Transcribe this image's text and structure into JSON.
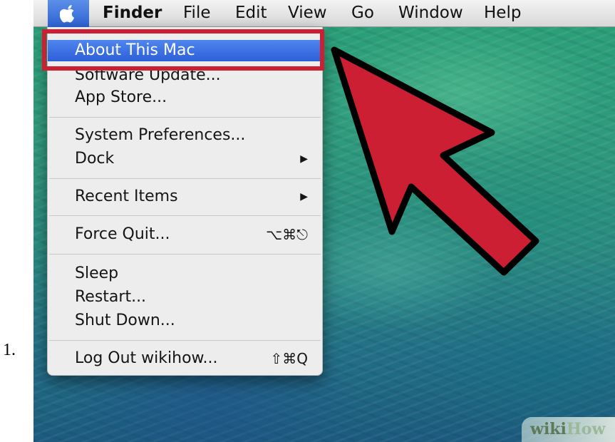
{
  "list_number": "1.",
  "menubar": {
    "items": [
      "Finder",
      "File",
      "Edit",
      "View",
      "Go",
      "Window",
      "Help"
    ]
  },
  "apple_menu": {
    "items": [
      {
        "label": "About This Mac",
        "selected": true
      },
      {
        "label": "Software Update..."
      },
      {
        "label": "App Store..."
      },
      {
        "label": "System Preferences..."
      },
      {
        "label": "Dock",
        "submenu": true
      },
      {
        "label": "Recent Items",
        "submenu": true
      },
      {
        "label": "Force Quit...",
        "shortcut": "⌥⌘⎋"
      },
      {
        "label": "Sleep"
      },
      {
        "label": "Restart..."
      },
      {
        "label": "Shut Down..."
      },
      {
        "label": "Log Out wikihow...",
        "shortcut": "⇧⌘Q"
      }
    ],
    "submenu_arrow": "▶"
  },
  "annotation": {
    "color": "#cd1f33",
    "arrow_icon": "pointer-arrow-icon"
  },
  "watermark": {
    "part1": "wiki",
    "part2": "How"
  }
}
